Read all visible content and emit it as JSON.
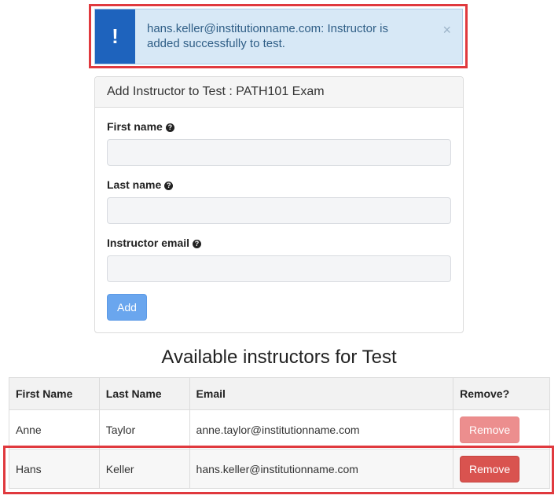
{
  "alert": {
    "icon": "!",
    "message": "hans.keller@institutionname.com: Instructor is added successfully to test.",
    "close": "×"
  },
  "panel": {
    "title": "Add Instructor to Test : PATH101 Exam",
    "fields": [
      {
        "label": "First name",
        "value": ""
      },
      {
        "label": "Last name",
        "value": ""
      },
      {
        "label": "Instructor email",
        "value": ""
      }
    ],
    "help_icon": "?",
    "add_label": "Add"
  },
  "section_title": "Available instructors for Test",
  "table": {
    "headers": [
      "First Name",
      "Last Name",
      "Email",
      "Remove?"
    ],
    "rows": [
      {
        "first": "Anne",
        "last": "Taylor",
        "email": "anne.taylor@institutionname.com",
        "action": "Remove"
      },
      {
        "first": "Hans",
        "last": "Keller",
        "email": "hans.keller@institutionname.com",
        "action": "Remove"
      }
    ]
  },
  "colors": {
    "alert_accent": "#1e63bd",
    "highlight_outline": "#e0393e",
    "remove_button": "#d9534f",
    "add_button": "#6aa6ee"
  }
}
